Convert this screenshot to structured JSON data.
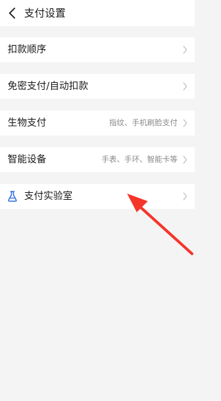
{
  "header": {
    "title": "支付设置",
    "back_icon": "chevron-left-icon"
  },
  "rows": [
    {
      "label": "扣款顺序",
      "sub": "",
      "icon": ""
    },
    {
      "label": "免密支付/自动扣款",
      "sub": "",
      "icon": ""
    },
    {
      "label": "生物支付",
      "sub": "指纹、手机刷脸支付",
      "icon": ""
    },
    {
      "label": "智能设备",
      "sub": "手表、手环、智能卡等",
      "icon": ""
    },
    {
      "label": "支付实验室",
      "sub": "",
      "icon": "flask-icon"
    }
  ],
  "colors": {
    "background": "#f4f4f4",
    "surface": "#ffffff",
    "text": "#1a1a1a",
    "subtext": "#8a8a8a",
    "chevron": "#c2c2c2",
    "flask": "#2f6fe4",
    "annotation_arrow": "#f5352a"
  }
}
